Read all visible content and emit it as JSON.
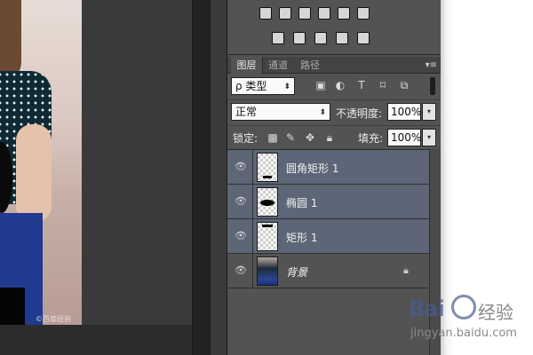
{
  "adjustments": {
    "row1_icons": [
      "levels-icon",
      "balance-icon",
      "blackwhite-icon",
      "photo-filter-icon",
      "channel-mixer-icon",
      "color-lookup-icon"
    ],
    "row2_icons": [
      "invert-icon",
      "posterize-icon",
      "threshold-icon",
      "selective-color-icon",
      "gradient-map-icon"
    ]
  },
  "tabs": [
    {
      "label": "图层",
      "active": true
    },
    {
      "label": "通道",
      "active": false
    },
    {
      "label": "路径",
      "active": false
    }
  ],
  "menu_icon": "▾≡",
  "filter": {
    "kind_label": "ρ 类型",
    "icons": {
      "image": "▣",
      "adjust": "◐",
      "type": "T",
      "shape": "⌑",
      "smart": "⧉"
    }
  },
  "blend": {
    "mode": "正常",
    "opacity_label": "不透明度:",
    "opacity_value": "100%"
  },
  "lock": {
    "label": "锁定:",
    "fill_label": "填充:",
    "fill_value": "100%"
  },
  "layers": [
    {
      "name": "圆角矩形 1",
      "selected": true,
      "shape": "rounded-rect"
    },
    {
      "name": "椭圆 1",
      "selected": true,
      "shape": "ellipse"
    },
    {
      "name": "矩形 1",
      "selected": true,
      "shape": "rect"
    },
    {
      "name": "背景",
      "selected": false,
      "shape": "photo",
      "locked": true
    }
  ],
  "watermark": {
    "photo": "©百度经验",
    "brand": "Bai",
    "brand2": "经验",
    "url": "jingyan.baidu.com"
  }
}
